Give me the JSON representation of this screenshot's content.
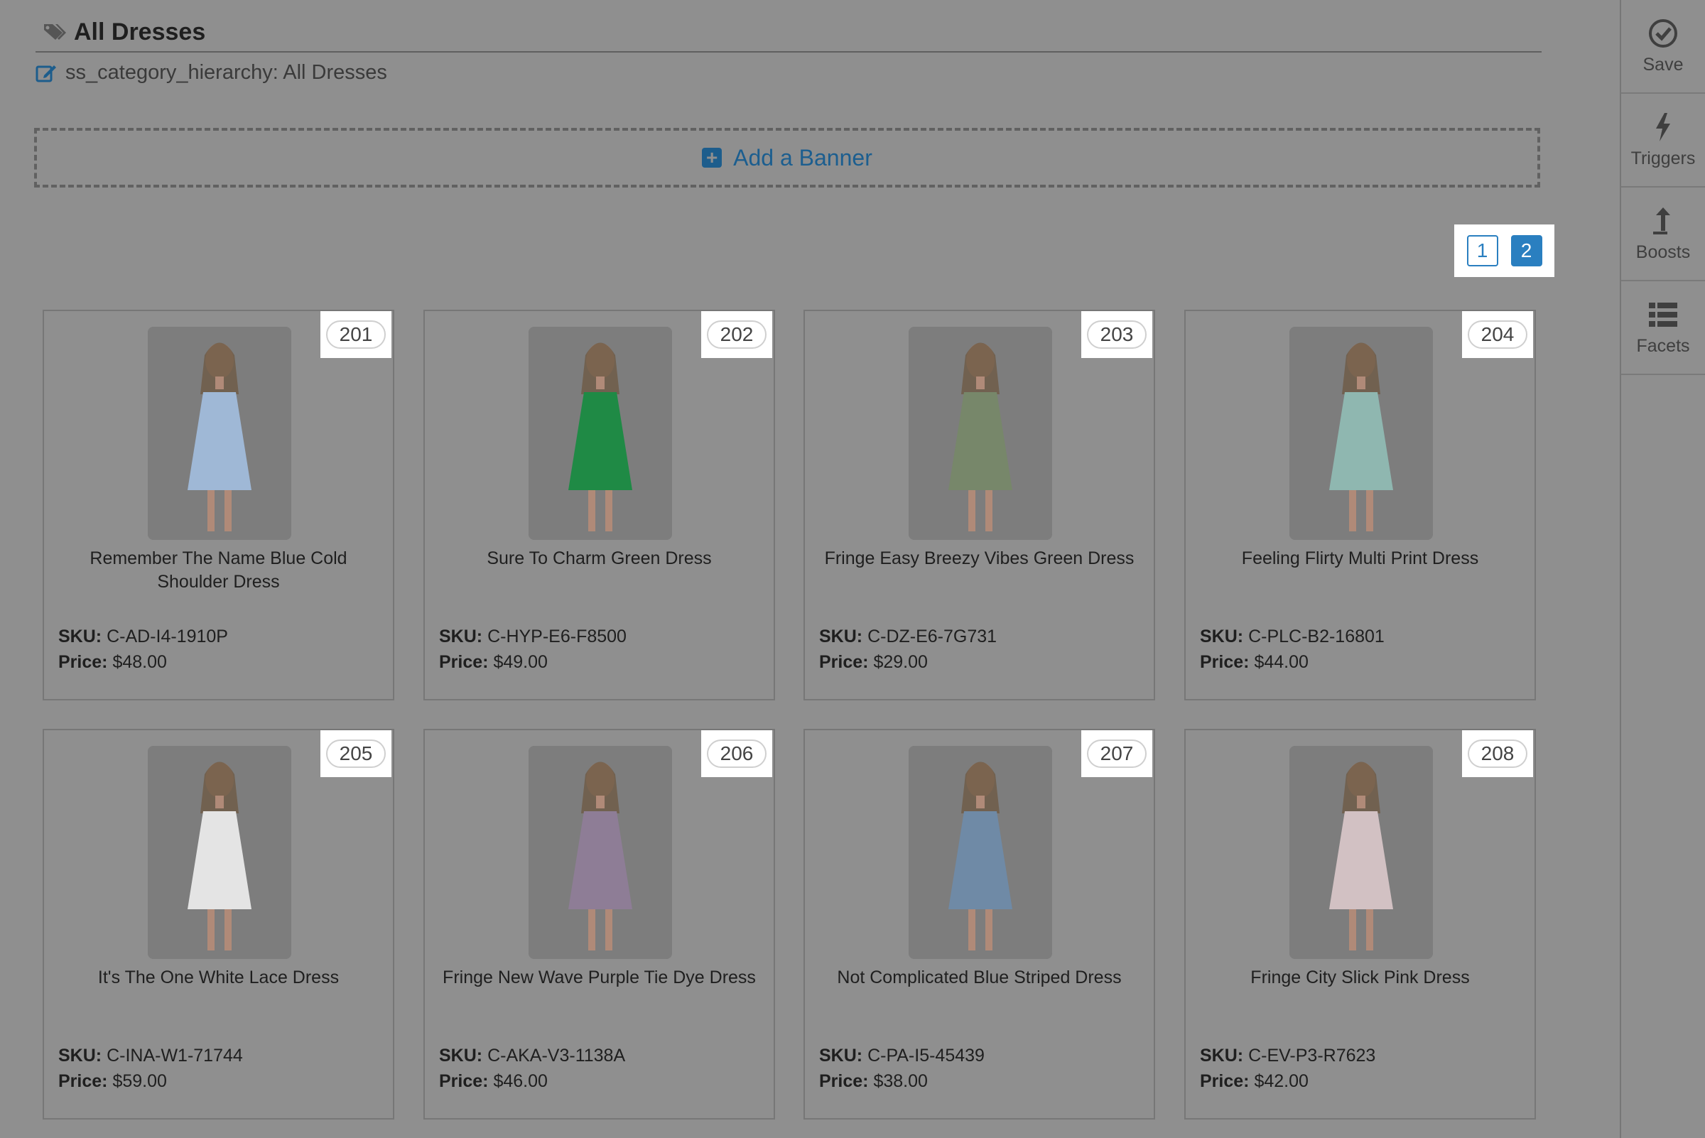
{
  "header": {
    "title": "All Dresses",
    "tag_icon": "tag-icon"
  },
  "subtitle": {
    "text": "ss_category_hierarchy: All Dresses",
    "icon": "edit-icon"
  },
  "banner": {
    "label": "Add a Banner",
    "icon": "plus-square-icon"
  },
  "pagination": {
    "pages": [
      "1",
      "2"
    ],
    "active": "2"
  },
  "products": [
    {
      "rank": "201",
      "name": "Remember The Name Blue Cold Shoulder Dress",
      "sku_label": "SKU:",
      "sku": "C-AD-I4-1910P",
      "price_label": "Price:",
      "price": "$48.00",
      "dress_color": "#9fb8d6"
    },
    {
      "rank": "202",
      "name": "Sure To Charm Green Dress",
      "sku_label": "SKU:",
      "sku": "C-HYP-E6-F8500",
      "price_label": "Price:",
      "price": "$49.00",
      "dress_color": "#1f8a45"
    },
    {
      "rank": "203",
      "name": "Fringe Easy Breezy Vibes Green Dress",
      "sku_label": "SKU:",
      "sku": "C-DZ-E6-7G731",
      "price_label": "Price:",
      "price": "$29.00",
      "dress_color": "#77876a"
    },
    {
      "rank": "204",
      "name": "Feeling Flirty Multi Print Dress",
      "sku_label": "SKU:",
      "sku": "C-PLC-B2-16801",
      "price_label": "Price:",
      "price": "$44.00",
      "dress_color": "#8fb7b0"
    },
    {
      "rank": "205",
      "name": "It's The One White Lace Dress",
      "sku_label": "SKU:",
      "sku": "C-INA-W1-71744",
      "price_label": "Price:",
      "price": "$59.00",
      "dress_color": "#e4e4e4"
    },
    {
      "rank": "206",
      "name": "Fringe New Wave Purple Tie Dye Dress",
      "sku_label": "SKU:",
      "sku": "C-AKA-V3-1138A",
      "price_label": "Price:",
      "price": "$46.00",
      "dress_color": "#8e7d96"
    },
    {
      "rank": "207",
      "name": "Not Complicated Blue Striped Dress",
      "sku_label": "SKU:",
      "sku": "C-PA-I5-45439",
      "price_label": "Price:",
      "price": "$38.00",
      "dress_color": "#6f8aa6"
    },
    {
      "rank": "208",
      "name": "Fringe City Slick Pink Dress",
      "sku_label": "SKU:",
      "sku": "C-EV-P3-R7623",
      "price_label": "Price:",
      "price": "$42.00",
      "dress_color": "#d2c1c3"
    }
  ],
  "sidebar": {
    "items": [
      {
        "label": "Save",
        "icon": "check-circle-icon"
      },
      {
        "label": "Triggers",
        "icon": "lightning-icon"
      },
      {
        "label": "Boosts",
        "icon": "arrow-up-icon"
      },
      {
        "label": "Facets",
        "icon": "list-icon"
      }
    ]
  }
}
